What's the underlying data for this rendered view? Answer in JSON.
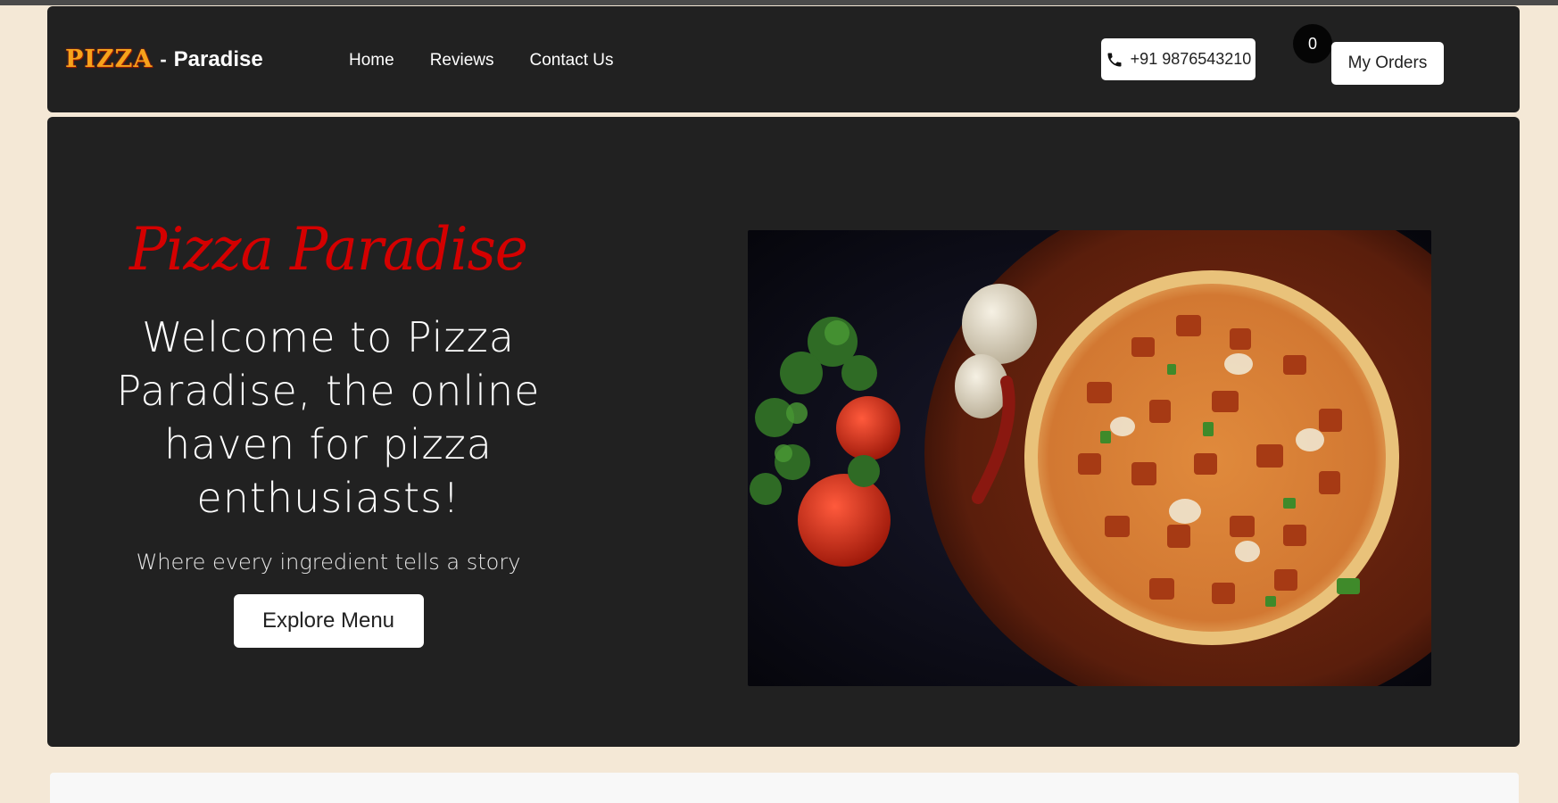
{
  "brand": {
    "logo_text": "PIZZA",
    "separator": "-",
    "name": "Paradise"
  },
  "nav": {
    "items": [
      {
        "label": "Home"
      },
      {
        "label": "Reviews"
      },
      {
        "label": "Contact Us"
      }
    ]
  },
  "header": {
    "phone": "+91 9876543210",
    "phone_icon": "phone-icon",
    "cart_count": "0",
    "orders_label": "My Orders"
  },
  "hero": {
    "title": "Pizza Paradise",
    "heading": "Welcome to Pizza Paradise, the online haven for pizza enthusiasts!",
    "subheading": "Where every ingredient tells a story",
    "cta_label": "Explore Menu",
    "image": "pizza-photo"
  },
  "colors": {
    "background": "#f4e8d6",
    "panel": "#212121",
    "accent_red": "#d40000",
    "button_bg": "#ffffff"
  }
}
